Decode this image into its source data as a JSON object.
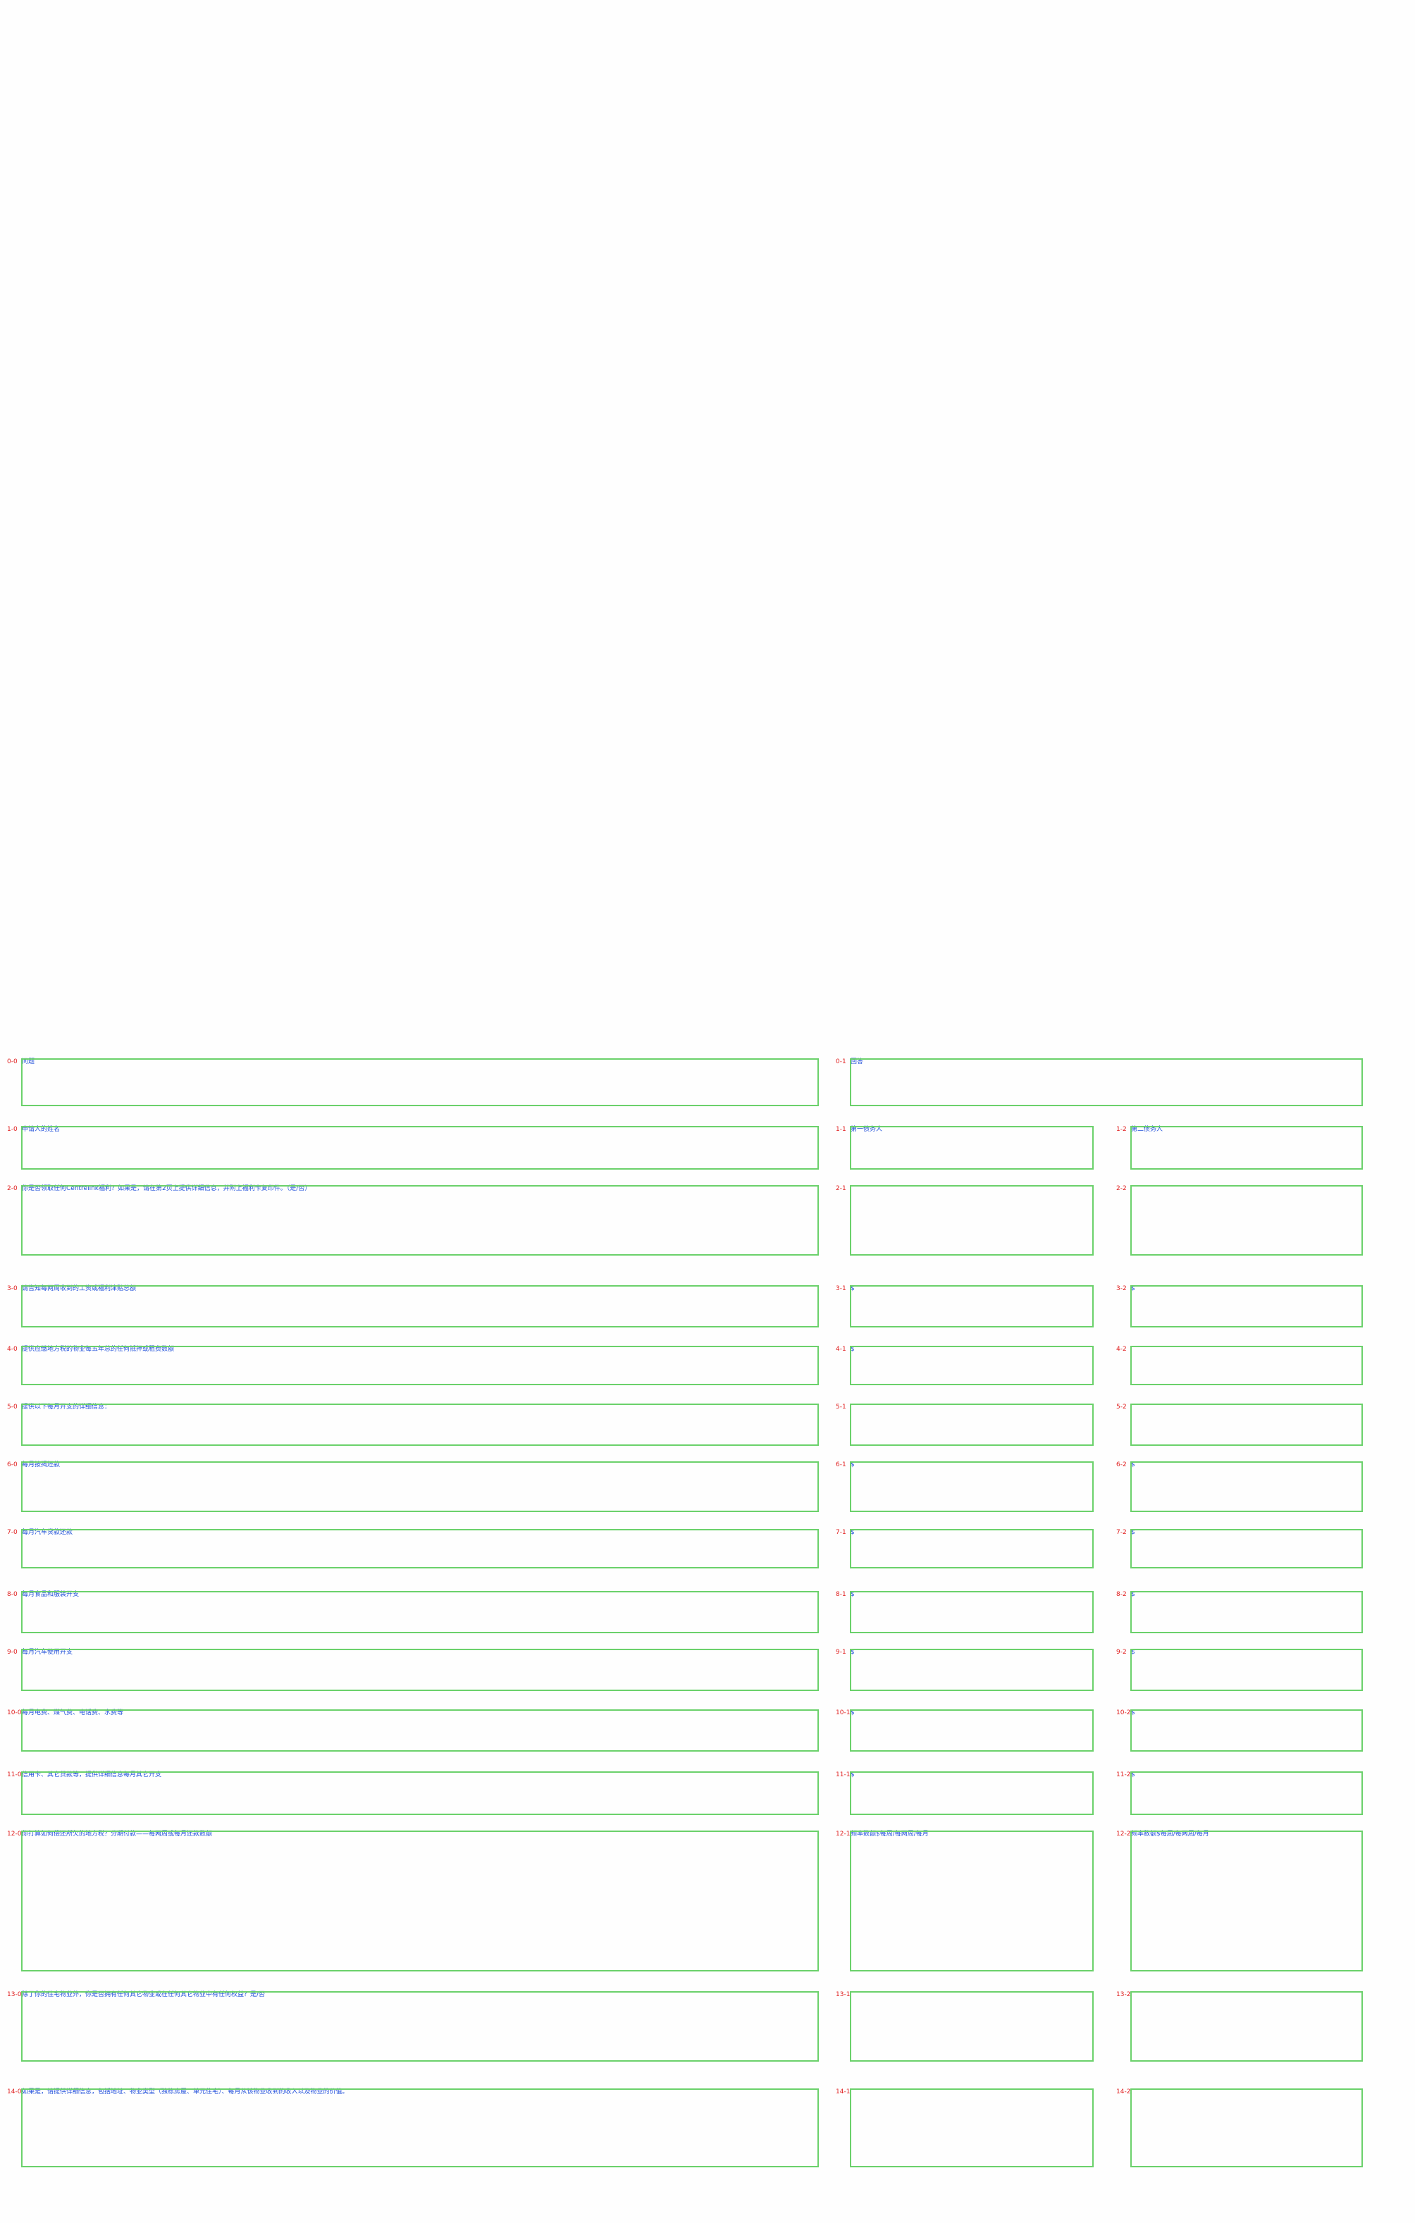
{
  "rows": [
    {
      "cells": [
        {
          "id": "0-0",
          "label": "问题"
        },
        {
          "id": "0-1",
          "label": "回答"
        }
      ]
    },
    {
      "cells": [
        {
          "id": "1-0",
          "label": "申请人的姓名"
        },
        {
          "id": "1-1",
          "label": "第一债务人"
        },
        {
          "id": "1-2",
          "label": "第二债务人"
        }
      ]
    },
    {
      "cells": [
        {
          "id": "2-0",
          "label": "你是否领取任何Centrelink福利？如果是，请在第2页上提供详细信息，并附上福利卡复印件。（是/否）"
        },
        {
          "id": "2-1",
          "label": ""
        },
        {
          "id": "2-2",
          "label": ""
        }
      ]
    },
    {
      "cells": [
        {
          "id": "3-0",
          "label": "请告知每两周收到的工资或福利津贴总额"
        },
        {
          "id": "3-1",
          "label": "$"
        },
        {
          "id": "3-2",
          "label": "$"
        }
      ]
    },
    {
      "cells": [
        {
          "id": "4-0",
          "label": "提供应缴地方税的物业每五年总的任何抵押或租费数额"
        },
        {
          "id": "4-1",
          "label": "$"
        },
        {
          "id": "4-2",
          "label": ""
        }
      ]
    },
    {
      "cells": [
        {
          "id": "5-0",
          "label": "提供以下每月开支的详细信息："
        },
        {
          "id": "5-1",
          "label": ""
        },
        {
          "id": "5-2",
          "label": ""
        }
      ]
    },
    {
      "cells": [
        {
          "id": "6-0",
          "label": "每月按揭还款"
        },
        {
          "id": "6-1",
          "label": "$"
        },
        {
          "id": "6-2",
          "label": "$"
        }
      ]
    },
    {
      "cells": [
        {
          "id": "7-0",
          "label": "每月汽车贷款还款"
        },
        {
          "id": "7-1",
          "label": "$"
        },
        {
          "id": "7-2",
          "label": "$"
        }
      ]
    },
    {
      "cells": [
        {
          "id": "8-0",
          "label": "每月食品和服装开支"
        },
        {
          "id": "8-1",
          "label": "$"
        },
        {
          "id": "8-2",
          "label": "$"
        }
      ]
    },
    {
      "cells": [
        {
          "id": "9-0",
          "label": "每月汽车使用开支"
        },
        {
          "id": "9-1",
          "label": "$"
        },
        {
          "id": "9-2",
          "label": "$"
        }
      ]
    },
    {
      "cells": [
        {
          "id": "10-0",
          "label": "每月电费、煤气费、电话费、水费等"
        },
        {
          "id": "10-1",
          "label": "$"
        },
        {
          "id": "10-2",
          "label": "$"
        }
      ]
    },
    {
      "cells": [
        {
          "id": "11-0",
          "label": "信用卡、其它贷款等，提供详细信息每月其它开支"
        },
        {
          "id": "11-1",
          "label": "$"
        },
        {
          "id": "11-2",
          "label": "$"
        }
      ]
    },
    {
      "cells": [
        {
          "id": "12-0",
          "label": "你打算如何偿还所欠的地方税？分期付款——每两周或每月还款数额"
        },
        {
          "id": "12-1",
          "label": "频率数额$每周/每两周/每月"
        },
        {
          "id": "12-2",
          "label": "频率数额$每周/每两周/每月"
        }
      ]
    },
    {
      "cells": [
        {
          "id": "13-0",
          "label": "除了你的住宅物业外，你是否拥有任何其它物业或在任何其它物业中有任何权益？是/否"
        },
        {
          "id": "13-1",
          "label": ""
        },
        {
          "id": "13-2",
          "label": ""
        }
      ]
    },
    {
      "cells": [
        {
          "id": "14-0",
          "label": "如果是，请提供详细信息，包括地址、物业类型（独栋房屋、单元住宅）、每月从该物业收到的收入以及物业的价值。"
        },
        {
          "id": "14-1",
          "label": ""
        },
        {
          "id": "14-2",
          "label": ""
        }
      ]
    }
  ]
}
